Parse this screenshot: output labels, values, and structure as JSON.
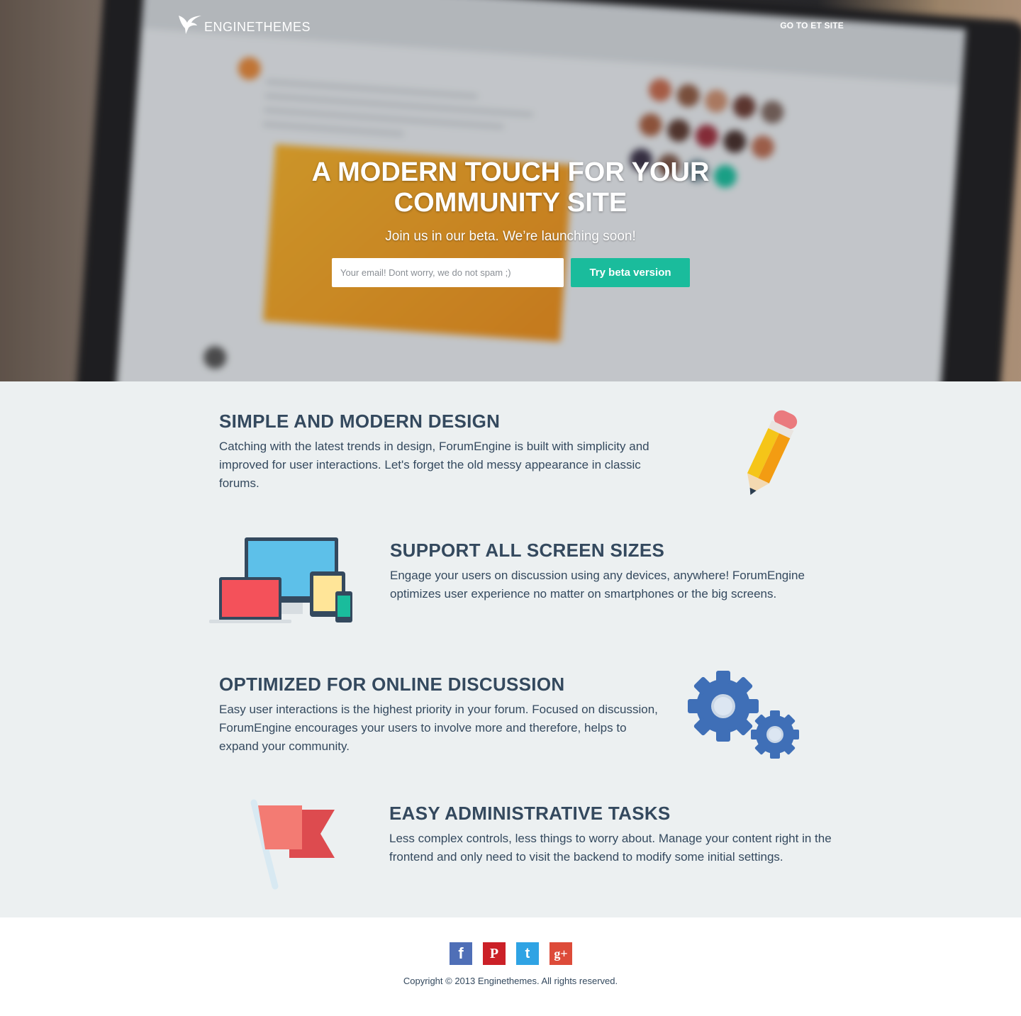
{
  "header": {
    "logo_text": "ENGINETHEMES",
    "nav_link": "GO TO ET SITE"
  },
  "hero": {
    "title_line1": "A MODERN TOUCH FOR YOUR",
    "title_line2": "COMMUNITY SITE",
    "subtitle": "Join us in our beta. We’re launching soon!",
    "email_placeholder": "Your email! Dont worry, we do not spam ;)",
    "email_value": "",
    "button_label": "Try beta version"
  },
  "features": [
    {
      "title": "SIMPLE AND MODERN DESIGN",
      "text": "Catching with the latest trends in design, ForumEngine is built with simplicity and improved for user interactions. Let's forget the old messy appearance in classic forums.",
      "icon": "pencil-icon"
    },
    {
      "title": "SUPPORT ALL SCREEN SIZES",
      "text": "Engage your users on discussion using any devices, anywhere! ForumEngine optimizes user experience no matter on smartphones or the big screens.",
      "icon": "devices-icon"
    },
    {
      "title": "OPTIMIZED FOR ONLINE DISCUSSION",
      "text": "Easy user interactions is the highest priority in your forum. Focused on discussion, ForumEngine encourages your users to involve more and therefore, helps to expand your community.",
      "icon": "gears-icon"
    },
    {
      "title": "EASY ADMINISTRATIVE TASKS",
      "text": "Less complex controls, less things to worry about. Manage your content right in the frontend and only need to visit the backend to modify some initial settings.",
      "icon": "flag-icon"
    }
  ],
  "footer": {
    "socials": [
      {
        "name": "facebook-icon",
        "glyph": "f",
        "color": "#4f6fb7"
      },
      {
        "name": "pinterest-icon",
        "glyph": "P",
        "color": "#cb2027"
      },
      {
        "name": "twitter-icon",
        "glyph": "t",
        "color": "#2fa3e4"
      },
      {
        "name": "google-plus-icon",
        "glyph": "g+",
        "color": "#dd4b39"
      }
    ],
    "copyright": "Copyright © 2013 Enginethemes. All rights reserved."
  },
  "colors": {
    "accent": "#1abc9c",
    "text": "#34495e",
    "features_bg": "#ecf0f1"
  }
}
